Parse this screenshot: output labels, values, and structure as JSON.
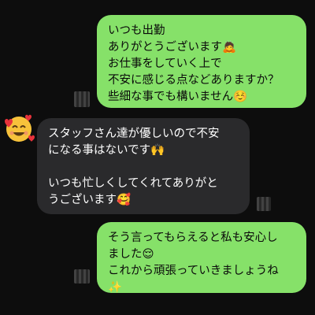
{
  "messages": [
    {
      "side": "sent",
      "lines": [
        "いつも出勤",
        "ありがとうございます🙇",
        "お仕事をしていく上で",
        "不安に感じる点などありますか？",
        "些細な事でも構いません☺️"
      ]
    },
    {
      "side": "received",
      "lines": [
        "スタッフさん達が優しいので不安",
        "になる事はないです🙌",
        "",
        "いつも忙しくしてくれてありがと",
        "うございます🥰"
      ]
    },
    {
      "side": "sent",
      "lines": [
        "そう言ってもらえると私も安心し",
        "ました😌",
        "これから頑張っていきましょうね",
        "✨"
      ]
    }
  ],
  "avatar": {
    "icon": "smiling-face-with-hearts-icon"
  },
  "colors": {
    "sent_bubble": "#86e169",
    "received_bubble": "#2a2a2c",
    "background": "#0d0d0d"
  }
}
